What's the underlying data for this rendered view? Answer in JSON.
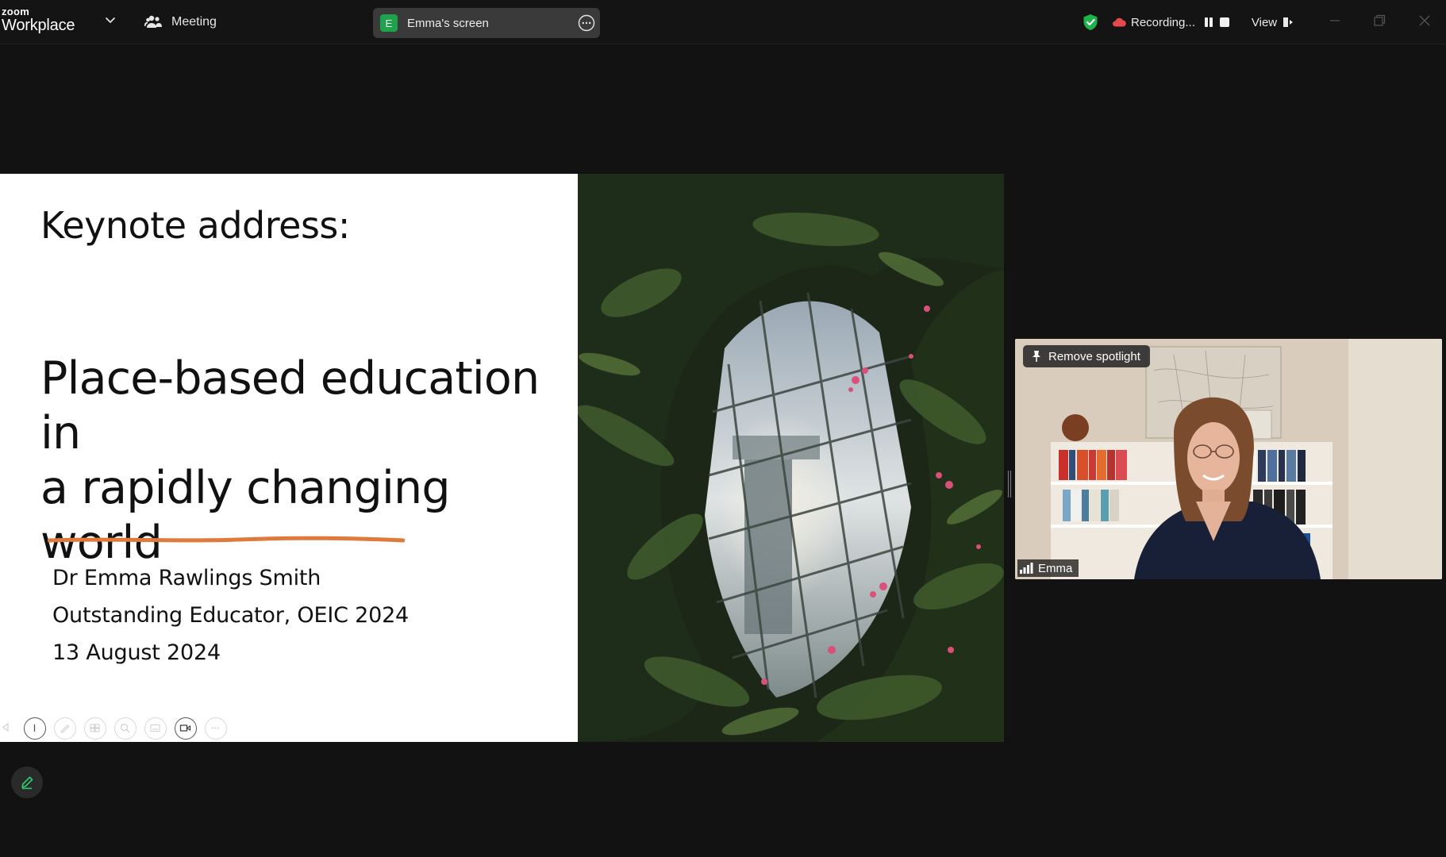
{
  "app": {
    "brand_small": "zoom",
    "brand_large": "Workplace"
  },
  "header": {
    "meeting_label": "Meeting",
    "screen_avatar_letter": "E",
    "screen_label": "Emma's screen",
    "recording_label": "Recording...",
    "view_label": "View"
  },
  "slide": {
    "heading": "Keynote address:",
    "title_line1": "Place-based education in",
    "title_line2": "a rapidly changing world",
    "presenter": "Dr Emma Rawlings Smith",
    "award": "Outstanding Educator, OEIC 2024",
    "date": "13 August 2024",
    "underline_color": "#e07a3c"
  },
  "slide_toolbar": {
    "icons": [
      "back-icon",
      "pointer-icon",
      "pen-icon",
      "slides-icon",
      "zoom-icon",
      "subtitles-icon",
      "video-icon",
      "more-icon"
    ]
  },
  "video": {
    "spotlight_label": "Remove spotlight",
    "participant_name": "Emma"
  },
  "colors": {
    "background": "#121212",
    "titlebar": "#141414",
    "pill": "#3a3a3a",
    "shield": "#1fb34a",
    "record_red": "#e5484d",
    "annotate_green": "#2ecc71"
  }
}
